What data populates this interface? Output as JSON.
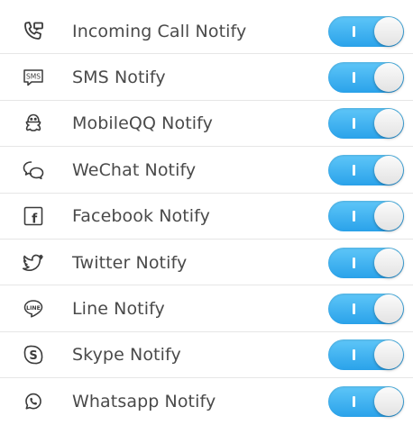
{
  "notifications": {
    "items": [
      {
        "label": "Incoming Call Notify",
        "icon": "phone-call-icon",
        "enabled": true
      },
      {
        "label": "SMS Notify",
        "icon": "sms-icon",
        "icon_text": "SMS",
        "enabled": true
      },
      {
        "label": "MobileQQ Notify",
        "icon": "qq-penguin-icon",
        "enabled": true
      },
      {
        "label": "WeChat Notify",
        "icon": "wechat-icon",
        "enabled": true
      },
      {
        "label": "Facebook Notify",
        "icon": "facebook-icon",
        "icon_text": "f",
        "enabled": true
      },
      {
        "label": "Twitter Notify",
        "icon": "twitter-bird-icon",
        "enabled": true
      },
      {
        "label": "Line Notify",
        "icon": "line-icon",
        "icon_text": "LINE",
        "enabled": true
      },
      {
        "label": "Skype Notify",
        "icon": "skype-icon",
        "icon_text": "S",
        "enabled": true
      },
      {
        "label": "Whatsapp Notify",
        "icon": "whatsapp-icon",
        "enabled": true
      }
    ]
  },
  "colors": {
    "toggle_on_top": "#5ec6f8",
    "toggle_on_bottom": "#2aa2ea",
    "label_text": "#4a4a4a",
    "icon_stroke": "#3b3b3b",
    "divider": "#e6e6e6"
  }
}
